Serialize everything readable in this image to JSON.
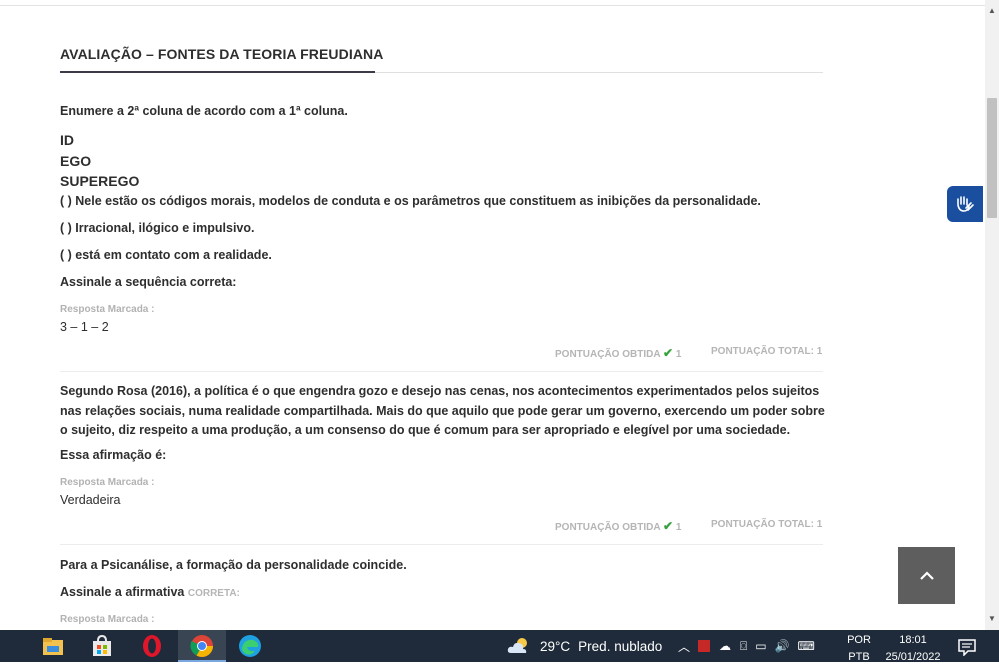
{
  "page": {
    "title": "AVALIAÇÃO – FONTES DA TEORIA FREUDIANA"
  },
  "q1": {
    "prompt": "Enumere a 2ª coluna de acordo com a 1ª coluna.",
    "items": [
      "ID",
      "EGO",
      "SUPEREGO"
    ],
    "options": [
      "( ) Nele estão os códigos morais, modelos de conduta e os parâmetros que constituem as inibições da personalidade.",
      "( ) Irracional, ilógico e impulsivo.",
      "( ) está em contato com a realidade."
    ],
    "instruction": "Assinale a sequência correta:",
    "answer_label": "Resposta Marcada :",
    "answer": "3 – 1 – 2",
    "score_obtained_label": "PONTUAÇÃO OBTIDA",
    "score_obtained": "1",
    "score_total_label": "PONTUAÇÃO TOTAL: 1"
  },
  "q2": {
    "text": "Segundo Rosa (2016), a política é o que engendra gozo e desejo nas cenas, nos acontecimentos experimentados pelos sujeitos nas relações sociais, numa realidade compartilhada. Mais do que aquilo que pode gerar um governo, exercendo um poder sobre o sujeito, diz respeito a uma produção, a um consenso do que é comum para ser apropriado e elegível por uma sociedade.",
    "instruction": "Essa afirmação é:",
    "answer_label": "Resposta Marcada :",
    "answer": "Verdadeira",
    "score_obtained_label": "PONTUAÇÃO OBTIDA",
    "score_obtained": "1",
    "score_total_label": "PONTUAÇÃO TOTAL: 1"
  },
  "q3": {
    "text": "Para a Psicanálise, a formação da personalidade coincide.",
    "instruction": "Assinale a afirmativa",
    "instruction_suffix": "CORRETA:",
    "answer_label": "Resposta Marcada :"
  },
  "taskbar": {
    "weather_temp": "29°C",
    "weather_desc": "Pred. nublado",
    "lang_top": "POR",
    "lang_bottom": "PTB",
    "time": "18:01",
    "date": "25/01/2022",
    "icons": [
      "file-explorer-icon",
      "store-icon",
      "opera-icon",
      "chrome-icon",
      "edge-icon"
    ]
  },
  "colors": {
    "accent": "#1a4fa0",
    "check": "#36a23c",
    "taskbar": "#1f2b3a"
  }
}
